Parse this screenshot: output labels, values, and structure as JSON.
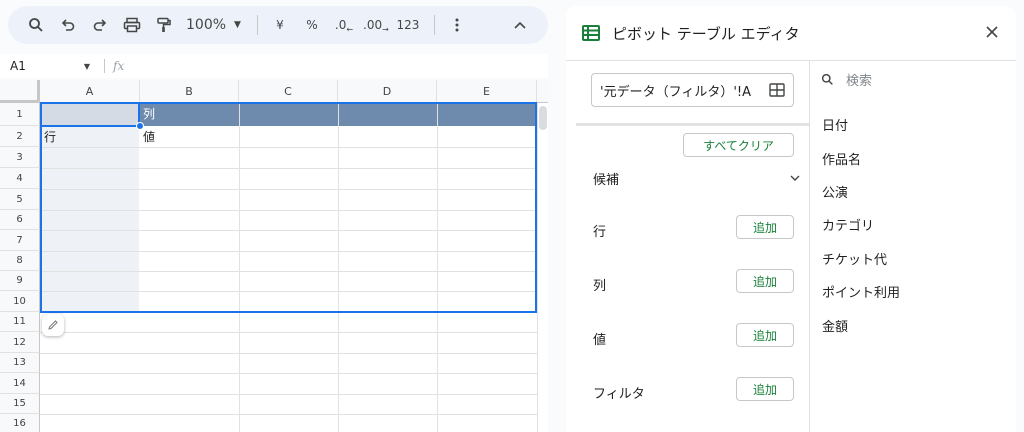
{
  "toolbar": {
    "zoom": "100%",
    "currency": "¥",
    "percent": "%",
    "dec_decrease": ".0",
    "dec_increase": ".00",
    "number_format": "123",
    "icons": [
      "search-icon",
      "undo-icon",
      "redo-icon",
      "print-icon",
      "paint-format-icon",
      "more-vert-icon",
      "chevron-up-icon"
    ]
  },
  "formula_bar": {
    "cell_ref": "A1",
    "fx": "fx",
    "value": ""
  },
  "grid": {
    "columns": [
      "A",
      "B",
      "C",
      "D",
      "E"
    ],
    "rows": [
      "1",
      "2",
      "3",
      "4",
      "5",
      "6",
      "7",
      "8",
      "9",
      "10",
      "11",
      "12",
      "13",
      "14",
      "15",
      "16"
    ],
    "cells": {
      "B1": "列",
      "A2": "行",
      "B2": "値"
    },
    "header_fill_color": "#6e8bae",
    "selection_color": "#1a73e8",
    "rowlabel_fill_color": "#eef1f5"
  },
  "panel": {
    "title": "ピボット テーブル エディタ",
    "range": "'元データ（フィルタ）'!A",
    "clear_all": "すべてクリア",
    "suggestions": "候補",
    "sections": [
      {
        "label": "行",
        "add": "追加"
      },
      {
        "label": "列",
        "add": "追加"
      },
      {
        "label": "値",
        "add": "追加"
      },
      {
        "label": "フィルタ",
        "add": "追加"
      }
    ],
    "search_placeholder": "検索",
    "fields": [
      "日付",
      "作品名",
      "公演",
      "カテゴリ",
      "チケット代",
      "ポイント利用",
      "金額"
    ],
    "accent_color": "#188038"
  }
}
